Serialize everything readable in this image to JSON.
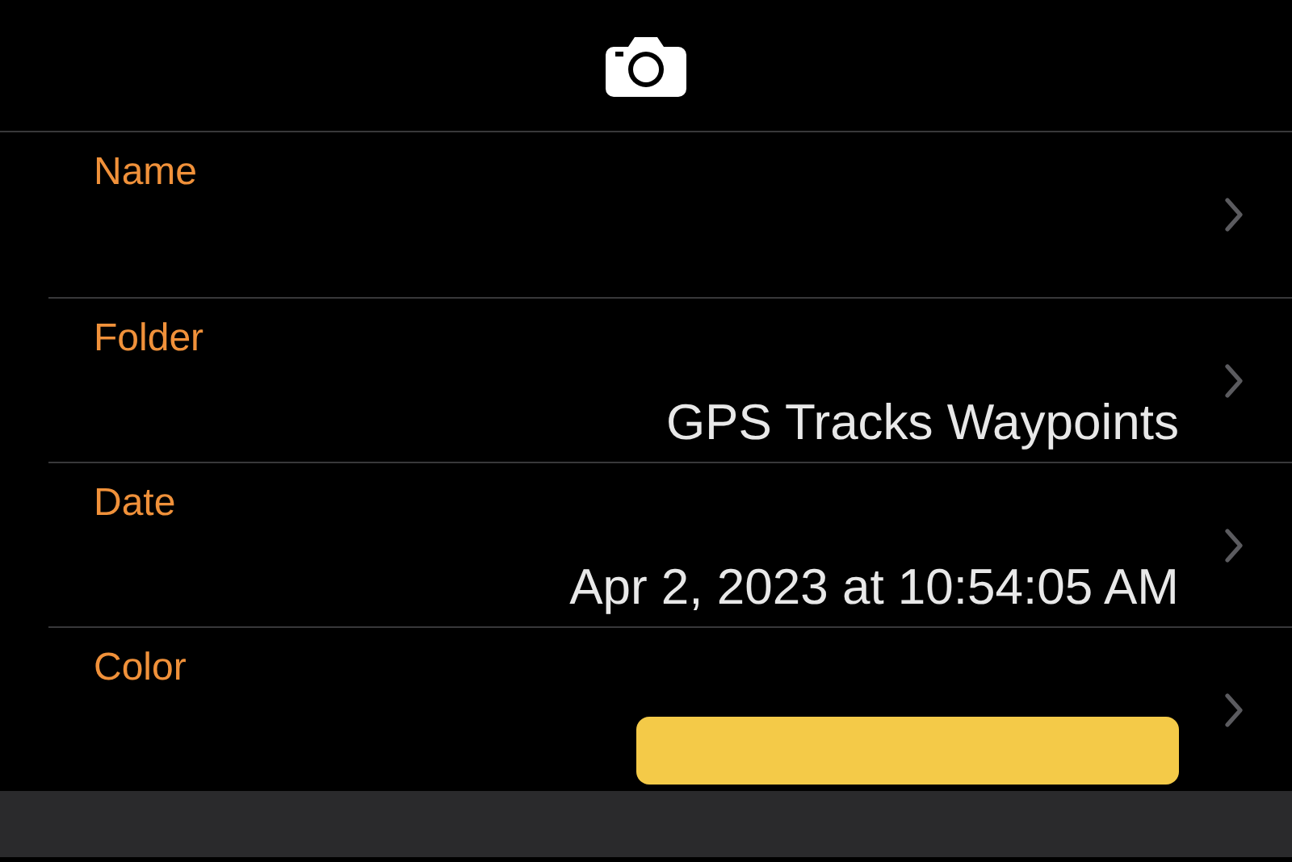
{
  "rows": [
    {
      "kind": "text",
      "label": "Name"
    },
    {
      "kind": "text",
      "label": "Folder",
      "value": "GPS Tracks Waypoints"
    },
    {
      "kind": "text",
      "label": "Date",
      "value": "Apr 2, 2023 at 10:54:05 AM"
    },
    {
      "kind": "color",
      "label": "Color",
      "color": "#f4ca48"
    }
  ]
}
